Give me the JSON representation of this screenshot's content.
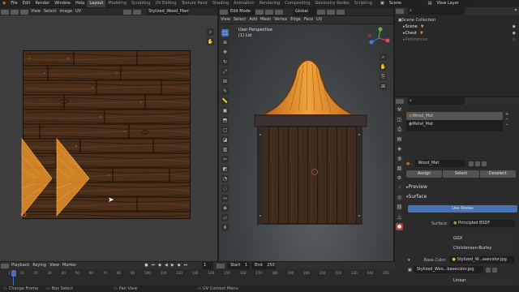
{
  "menu": {
    "items": [
      "File",
      "Edit",
      "Render",
      "Window",
      "Help"
    ],
    "workspaces": [
      "Layout",
      "Modeling",
      "Sculpting",
      "UV Editing",
      "Texture Paint",
      "Shading",
      "Animation",
      "Rendering",
      "Compositing",
      "Geometry Nodes",
      "Scripting"
    ],
    "active_workspace": "Layout",
    "scene": "Scene",
    "view_layer": "View Layer"
  },
  "uv_editor": {
    "menu": [
      "View",
      "Select",
      "Image",
      "UV"
    ],
    "image_name": "Stylized_Wood_Plank"
  },
  "viewport": {
    "mode": "Edit Mode",
    "menu": [
      "View",
      "Select",
      "Add",
      "Mesh",
      "Vertex",
      "Edge",
      "Face",
      "UV"
    ],
    "orientation": "Global",
    "overlay_title": "User Perspective",
    "overlay_subtitle": "(1) Lid"
  },
  "outliner": {
    "root": "Scene Collection",
    "items": [
      "Scene",
      "Chest",
      "References"
    ]
  },
  "properties": {
    "materials": [
      "Wood_Mat",
      "Metal_Mat"
    ],
    "active_material": "Wood_Mat",
    "buttons": {
      "assign": "Assign",
      "select": "Select",
      "deselect": "Deselect"
    },
    "preview_label": "Preview",
    "surface_label": "Surface",
    "use_nodes": "Use Nodes",
    "surface_field_label": "Surface",
    "surface_value": "Principled BSDF",
    "distribution": "GGX",
    "subsurface": "Christensen-Burley",
    "base_color_label": "Base Color",
    "base_color_value": "Stylized_W...asecolor.jpg",
    "image_block": "Stylized_Woo...basecolor.jpg",
    "interpolation": "Linear"
  },
  "timeline": {
    "menu": [
      "Playback",
      "Keying",
      "View",
      "Marker"
    ],
    "current_frame": "1",
    "start_label": "Start",
    "start": "1",
    "end_label": "End",
    "end": "250",
    "ticks": [
      "1",
      "10",
      "20",
      "30",
      "40",
      "50",
      "60",
      "70",
      "80",
      "90",
      "100",
      "110",
      "120",
      "130",
      "140",
      "150",
      "160",
      "170",
      "180",
      "190",
      "200",
      "210",
      "220",
      "230",
      "240",
      "250"
    ]
  },
  "statusbar": {
    "items": [
      "Change Frame",
      "Box Select",
      "Pan View",
      "UV Context Menu"
    ]
  },
  "colors": {
    "accent": "#4772b3",
    "wood_orange": "#e8902a",
    "wood_dark": "#4a2e1a"
  }
}
